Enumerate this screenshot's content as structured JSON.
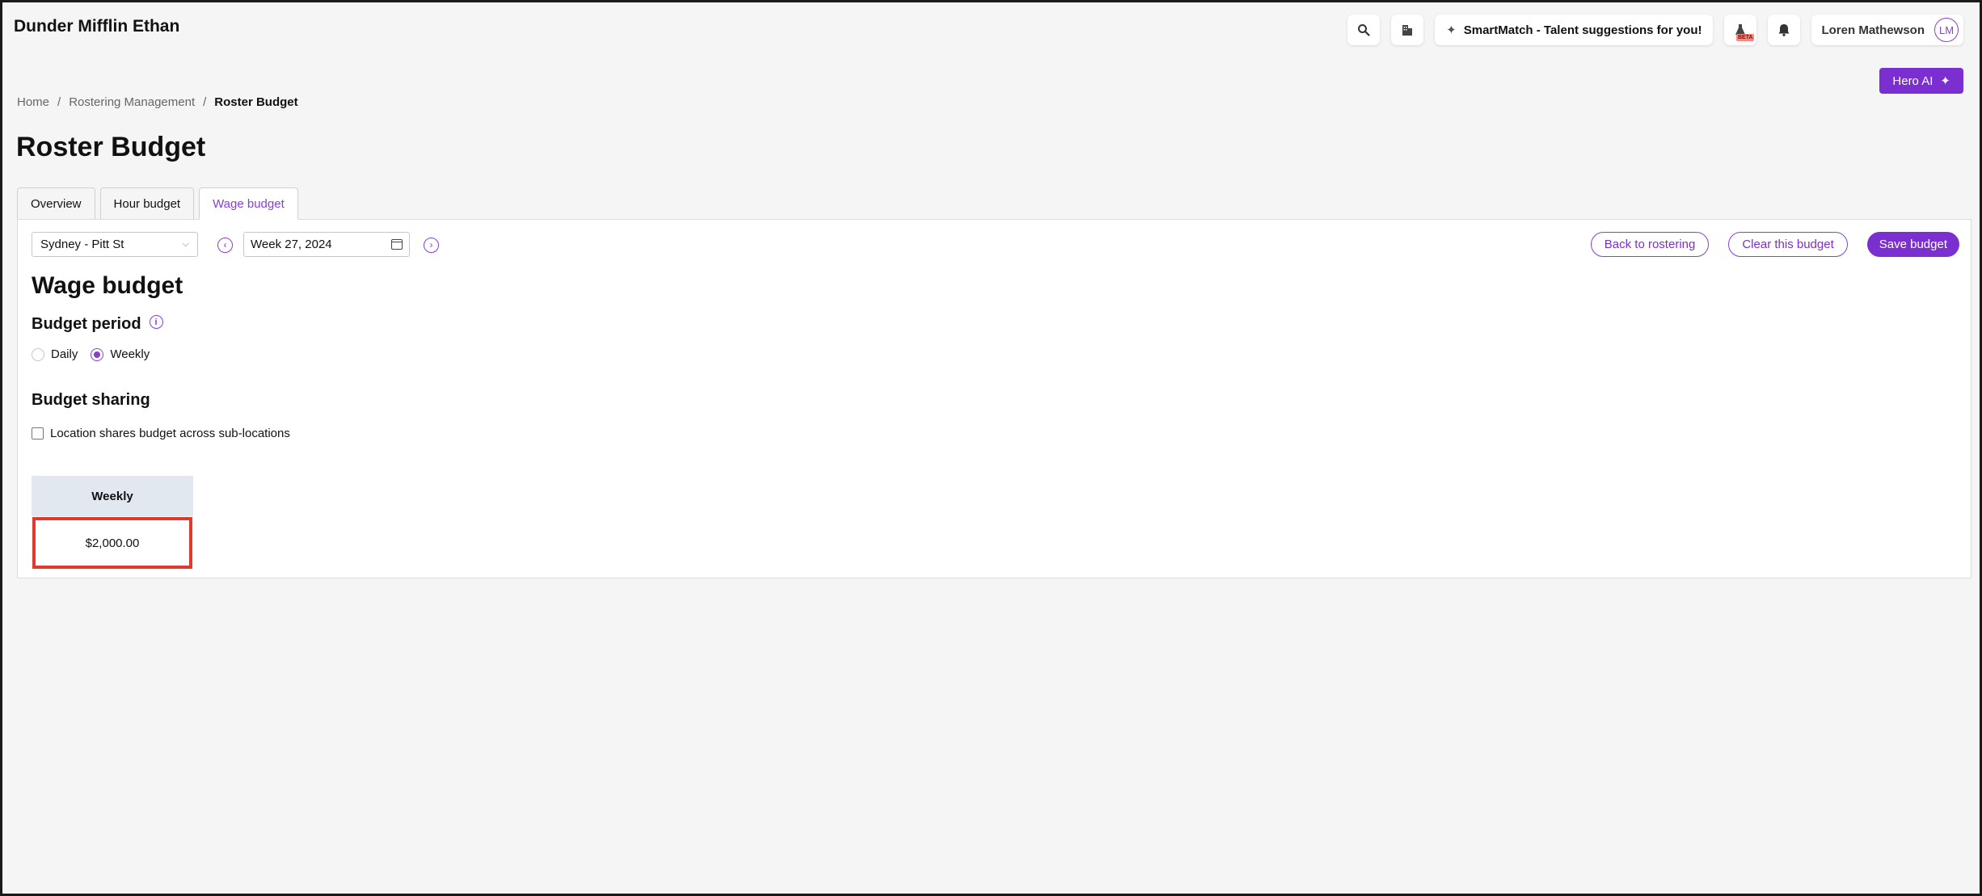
{
  "app": {
    "title": "Dunder Mifflin Ethan"
  },
  "topbar": {
    "smartmatch_label": "SmartMatch - Talent suggestions for you!",
    "beta_badge": "BETA",
    "user_name": "Loren Mathewson",
    "user_initials": "LM",
    "hero_ai_label": "Hero AI"
  },
  "breadcrumb": {
    "items": [
      "Home",
      "Rostering Management",
      "Roster Budget"
    ],
    "separator": "/"
  },
  "page": {
    "title": "Roster Budget"
  },
  "tabs": [
    {
      "label": "Overview",
      "active": false
    },
    {
      "label": "Hour budget",
      "active": false
    },
    {
      "label": "Wage budget",
      "active": true
    }
  ],
  "filters": {
    "location": "Sydney - Pitt St",
    "week": "Week 27, 2024"
  },
  "actions": {
    "back": "Back to rostering",
    "clear": "Clear this budget",
    "save": "Save budget"
  },
  "wage_budget": {
    "title": "Wage budget",
    "period_heading": "Budget period",
    "period_options": [
      {
        "label": "Daily",
        "selected": false
      },
      {
        "label": "Weekly",
        "selected": true
      }
    ],
    "sharing_heading": "Budget sharing",
    "sharing_checkbox_label": "Location shares budget across sub-locations",
    "sharing_checked": false,
    "table_header": "Weekly",
    "table_value": "$2,000.00"
  },
  "colors": {
    "accent": "#7b2fd0",
    "highlight_border": "#e03a2f",
    "table_header_bg": "#e2e8f0"
  }
}
